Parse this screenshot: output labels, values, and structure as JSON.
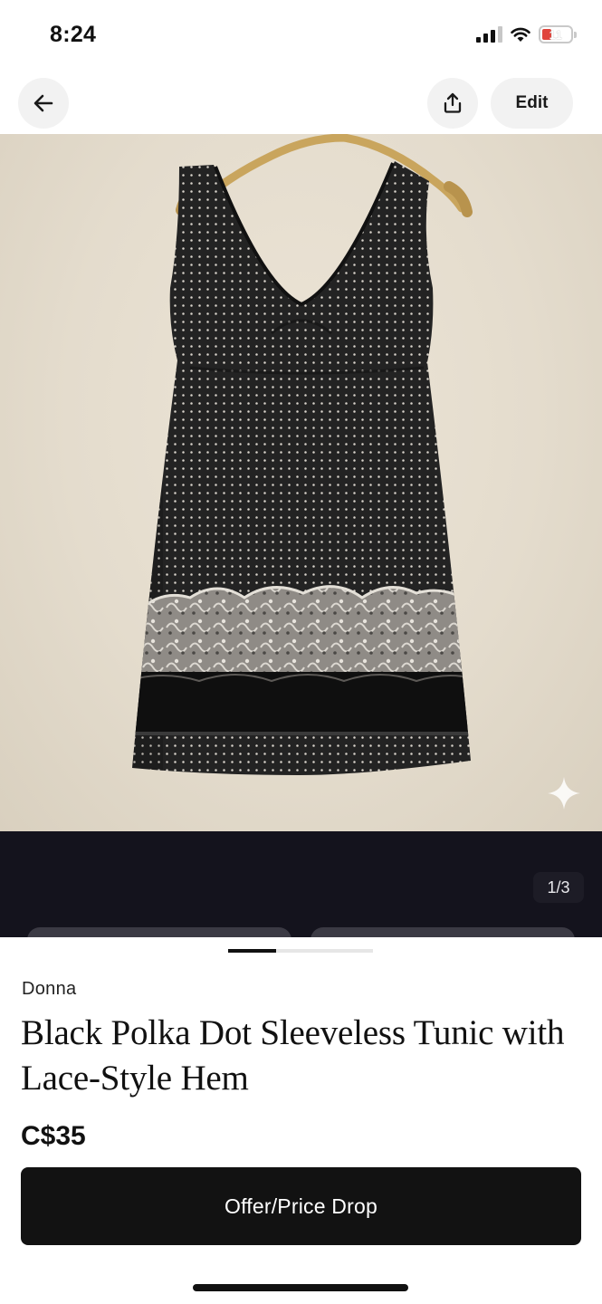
{
  "status": {
    "time": "8:24",
    "battery": "11"
  },
  "header": {
    "edit_label": "Edit"
  },
  "gallery": {
    "counter": "1/3",
    "current_index": 1,
    "total": 3,
    "progress_fraction": 0.33
  },
  "listing": {
    "brand": "Donna",
    "title": "Black Polka Dot Sleeveless Tunic with Lace-Style Hem",
    "price": "C$35"
  },
  "actions": {
    "offer_label": "Offer/Price Drop"
  },
  "colors": {
    "primary_button": "#121212",
    "battery_low": "#e0443c",
    "band": "#14131d"
  },
  "icons": [
    "back-arrow-icon",
    "share-icon",
    "sparkle-icon",
    "signal-icon",
    "wifi-icon",
    "battery-icon"
  ]
}
